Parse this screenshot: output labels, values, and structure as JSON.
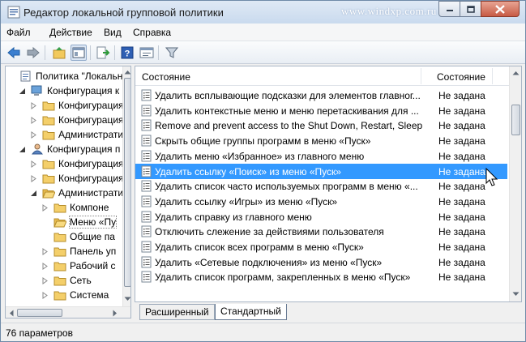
{
  "window": {
    "title": "Редактор локальной групповой политики",
    "watermark": "www.windxp.com.ru"
  },
  "menu": [
    "Файл",
    "Действие",
    "Вид",
    "Справка"
  ],
  "toolbar_icons": [
    "back-arrow-icon",
    "forward-arrow-icon",
    "up-folder-icon",
    "show-hide-tree-icon",
    "export-list-icon",
    "help-icon",
    "properties-icon",
    "filter-icon"
  ],
  "tree": [
    {
      "label": "Политика \"Локальный",
      "level": 0,
      "icon": "policy-icon",
      "twisty": "none"
    },
    {
      "label": "Конфигурация к",
      "level": 1,
      "icon": "computer-icon",
      "twisty": "expanded"
    },
    {
      "label": "Конфигурация",
      "level": 2,
      "icon": "folder-icon",
      "twisty": "collapsed"
    },
    {
      "label": "Конфигурация",
      "level": 2,
      "icon": "folder-icon",
      "twisty": "collapsed"
    },
    {
      "label": "Администрати",
      "level": 2,
      "icon": "folder-icon",
      "twisty": "collapsed"
    },
    {
      "label": "Конфигурация п",
      "level": 1,
      "icon": "user-icon",
      "twisty": "expanded"
    },
    {
      "label": "Конфигурация",
      "level": 2,
      "icon": "folder-icon",
      "twisty": "collapsed"
    },
    {
      "label": "Конфигурация",
      "level": 2,
      "icon": "folder-icon",
      "twisty": "collapsed"
    },
    {
      "label": "Администрати",
      "level": 2,
      "icon": "folder-open-icon",
      "twisty": "expanded"
    },
    {
      "label": "Компоне",
      "level": 3,
      "icon": "folder-icon",
      "twisty": "collapsed"
    },
    {
      "label": "Меню «Пу",
      "level": 3,
      "icon": "folder-open-icon",
      "twisty": "none",
      "selected": true
    },
    {
      "label": "Общие па",
      "level": 3,
      "icon": "folder-icon",
      "twisty": "none"
    },
    {
      "label": "Панель уп",
      "level": 3,
      "icon": "folder-icon",
      "twisty": "collapsed"
    },
    {
      "label": "Рабочий с",
      "level": 3,
      "icon": "folder-icon",
      "twisty": "collapsed"
    },
    {
      "label": "Сеть",
      "level": 3,
      "icon": "folder-icon",
      "twisty": "collapsed"
    },
    {
      "label": "Система",
      "level": 3,
      "icon": "folder-icon",
      "twisty": "collapsed"
    }
  ],
  "list": {
    "columns": [
      "Состояние",
      "Состояние"
    ],
    "rows": [
      {
        "name": "Удалить всплывающие подсказки для элементов главног...",
        "state": "Не задана"
      },
      {
        "name": "Удалить контекстные меню и меню перетаскивания для ...",
        "state": "Не задана"
      },
      {
        "name": "Remove and prevent access to the Shut Down, Restart, Sleep...",
        "state": "Не задана"
      },
      {
        "name": "Скрыть общие группы программ в меню «Пуск»",
        "state": "Не задана"
      },
      {
        "name": "Удалить меню «Избранное» из главного меню",
        "state": "Не задана"
      },
      {
        "name": "Удалить ссылку «Поиск» из меню «Пуск»",
        "state": "Не задана",
        "selected": true
      },
      {
        "name": "Удалить список часто используемых программ в меню «...",
        "state": "Не задана"
      },
      {
        "name": "Удалить ссылку «Игры» из меню «Пуск»",
        "state": "Не задана"
      },
      {
        "name": "Удалить справку из главного меню",
        "state": "Не задана"
      },
      {
        "name": "Отключить слежение за действиями пользователя",
        "state": "Не задана"
      },
      {
        "name": "Удалить список всех программ в меню «Пуск»",
        "state": "Не задана"
      },
      {
        "name": "Удалить «Сетевые подключения» из меню «Пуск»",
        "state": "Не задана"
      },
      {
        "name": "Удалить список программ, закрепленных в меню «Пуск»",
        "state": "Не задана"
      }
    ]
  },
  "tabs": {
    "extended": "Расширенный",
    "standard": "Стандартный"
  },
  "status": "76 параметров",
  "colors": {
    "selection": "#3399ff",
    "title_gradient_top": "#dfe9f5",
    "close_button": "#c75b45"
  }
}
